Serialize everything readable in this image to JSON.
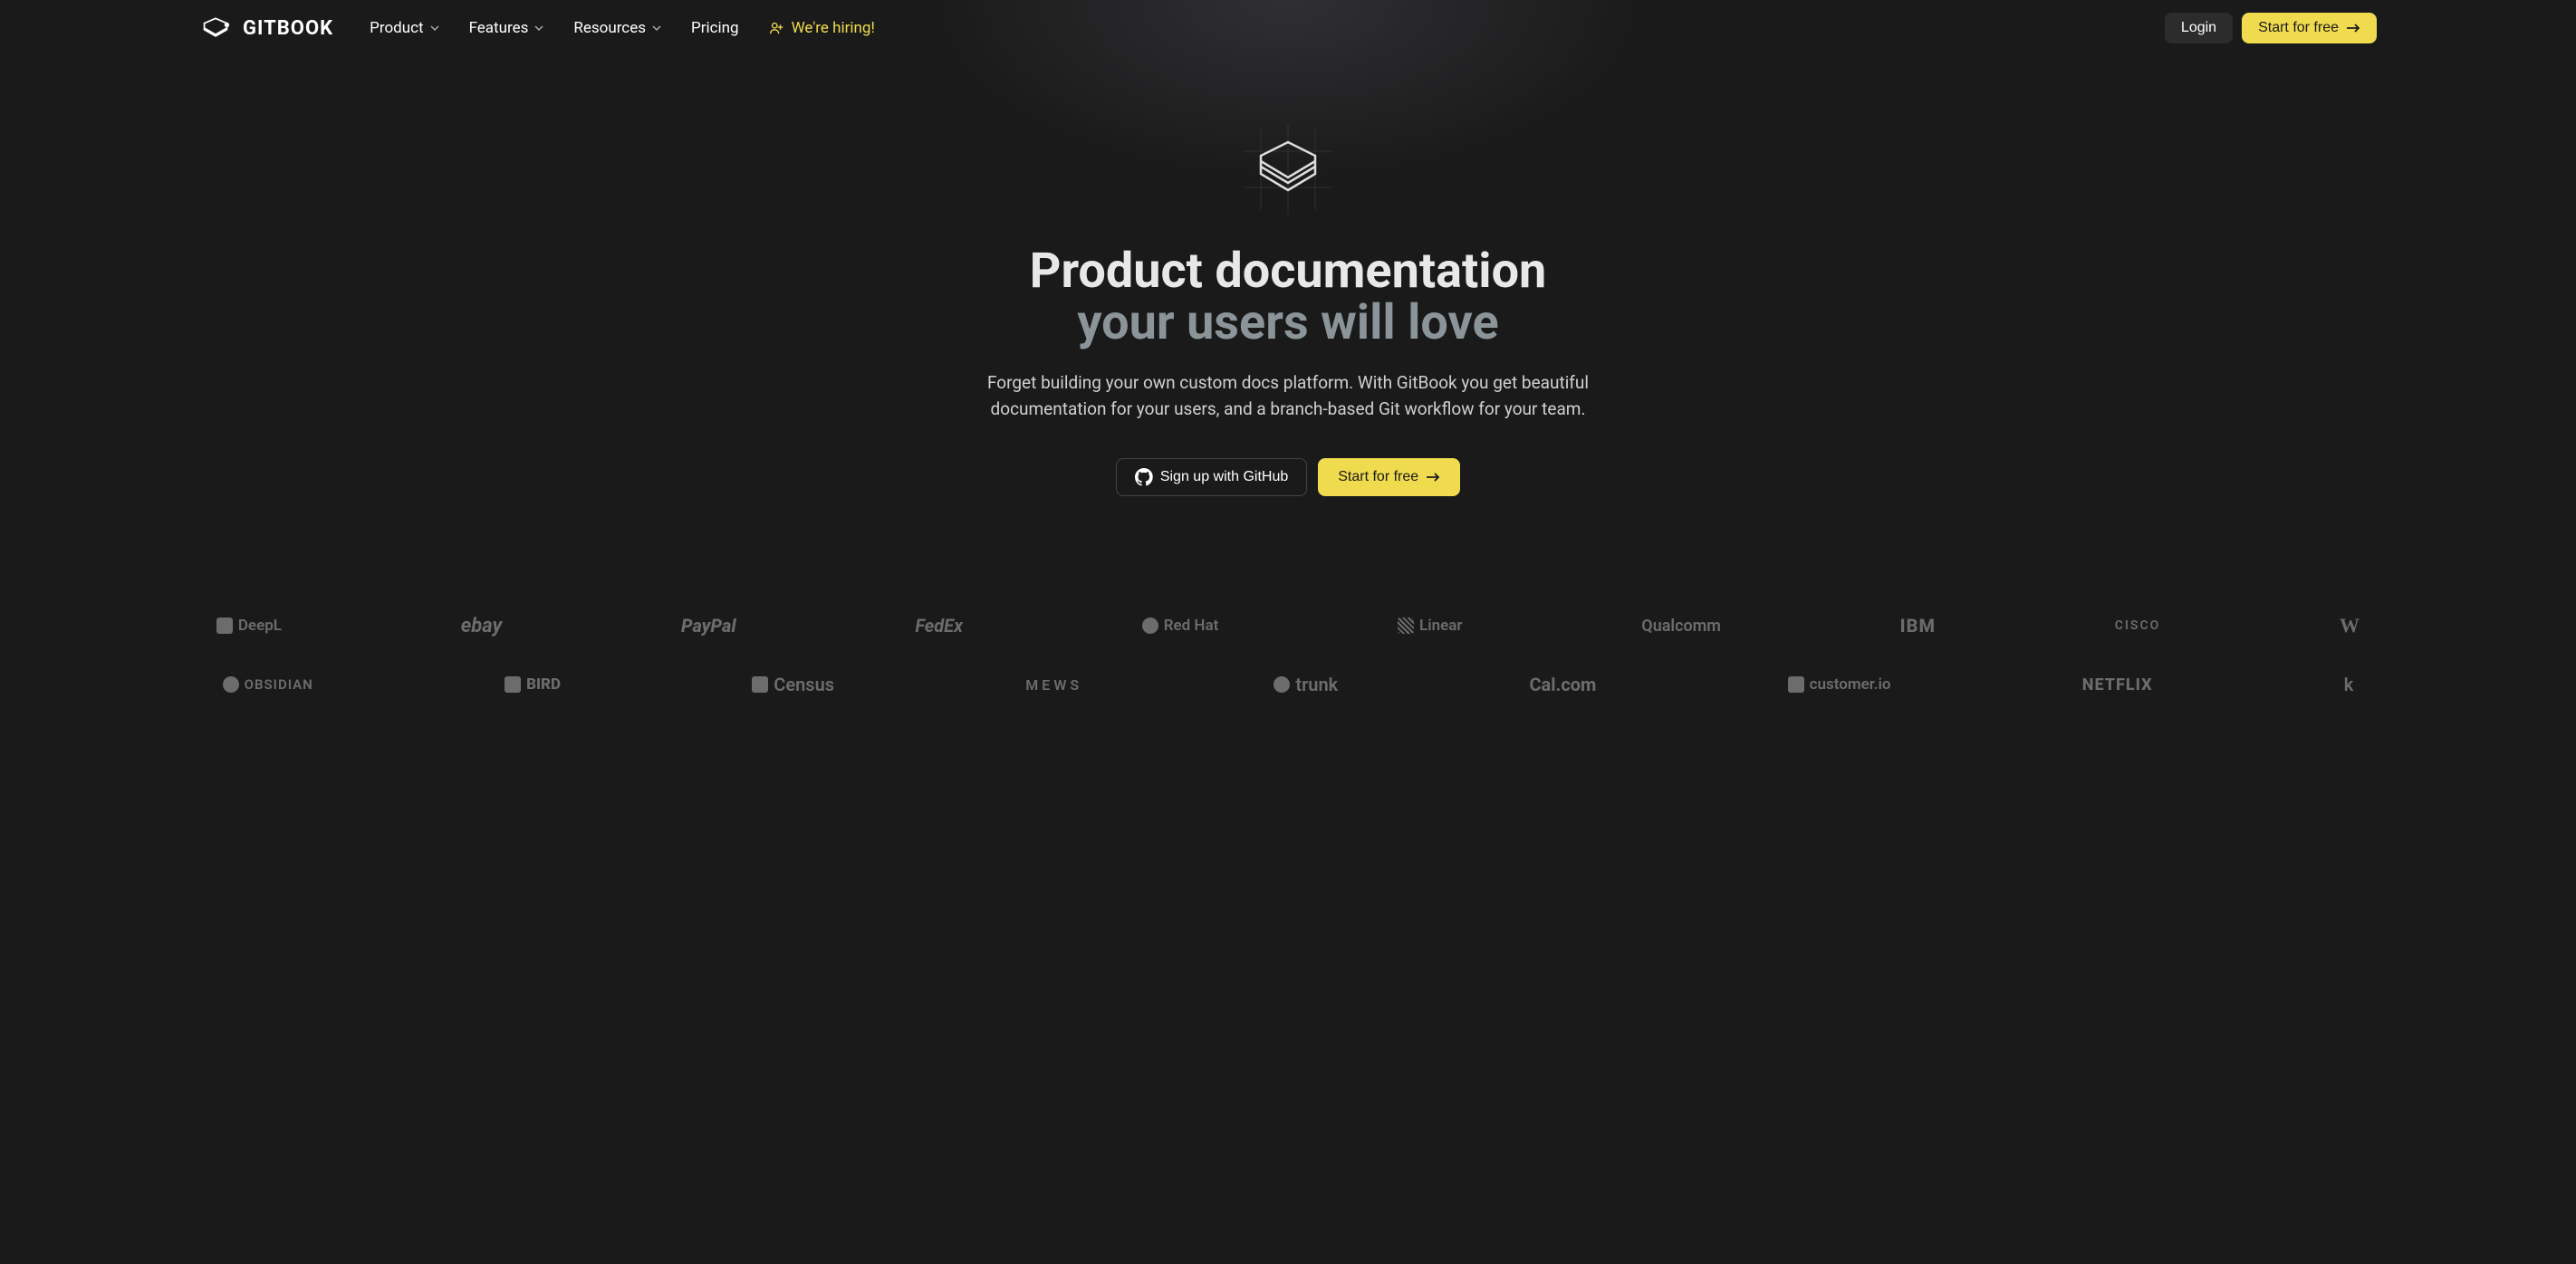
{
  "brand": "GITBOOK",
  "nav": {
    "product": "Product",
    "features": "Features",
    "resources": "Resources",
    "pricing": "Pricing",
    "hiring": "We're hiring!"
  },
  "header_actions": {
    "login": "Login",
    "start_free": "Start for free"
  },
  "hero": {
    "title_line1": "Product documentation",
    "title_line2": "your users will love",
    "subtitle": "Forget building your own custom docs platform. With GitBook you get beautiful documentation for your users, and a branch-based Git workflow for your team.",
    "github_signup": "Sign up with GitHub",
    "start_free": "Start for free"
  },
  "logos_row1": [
    "DeepL",
    "ebay",
    "PayPal",
    "FedEx",
    "Red Hat",
    "Linear",
    "Qualcomm",
    "IBM",
    "CISCO",
    "W"
  ],
  "logos_row2": [
    "OBSIDIAN",
    "BIRD",
    "Census",
    "MEWS",
    "trunk",
    "Cal.com",
    "customer.io",
    "NETFLIX",
    "k"
  ]
}
